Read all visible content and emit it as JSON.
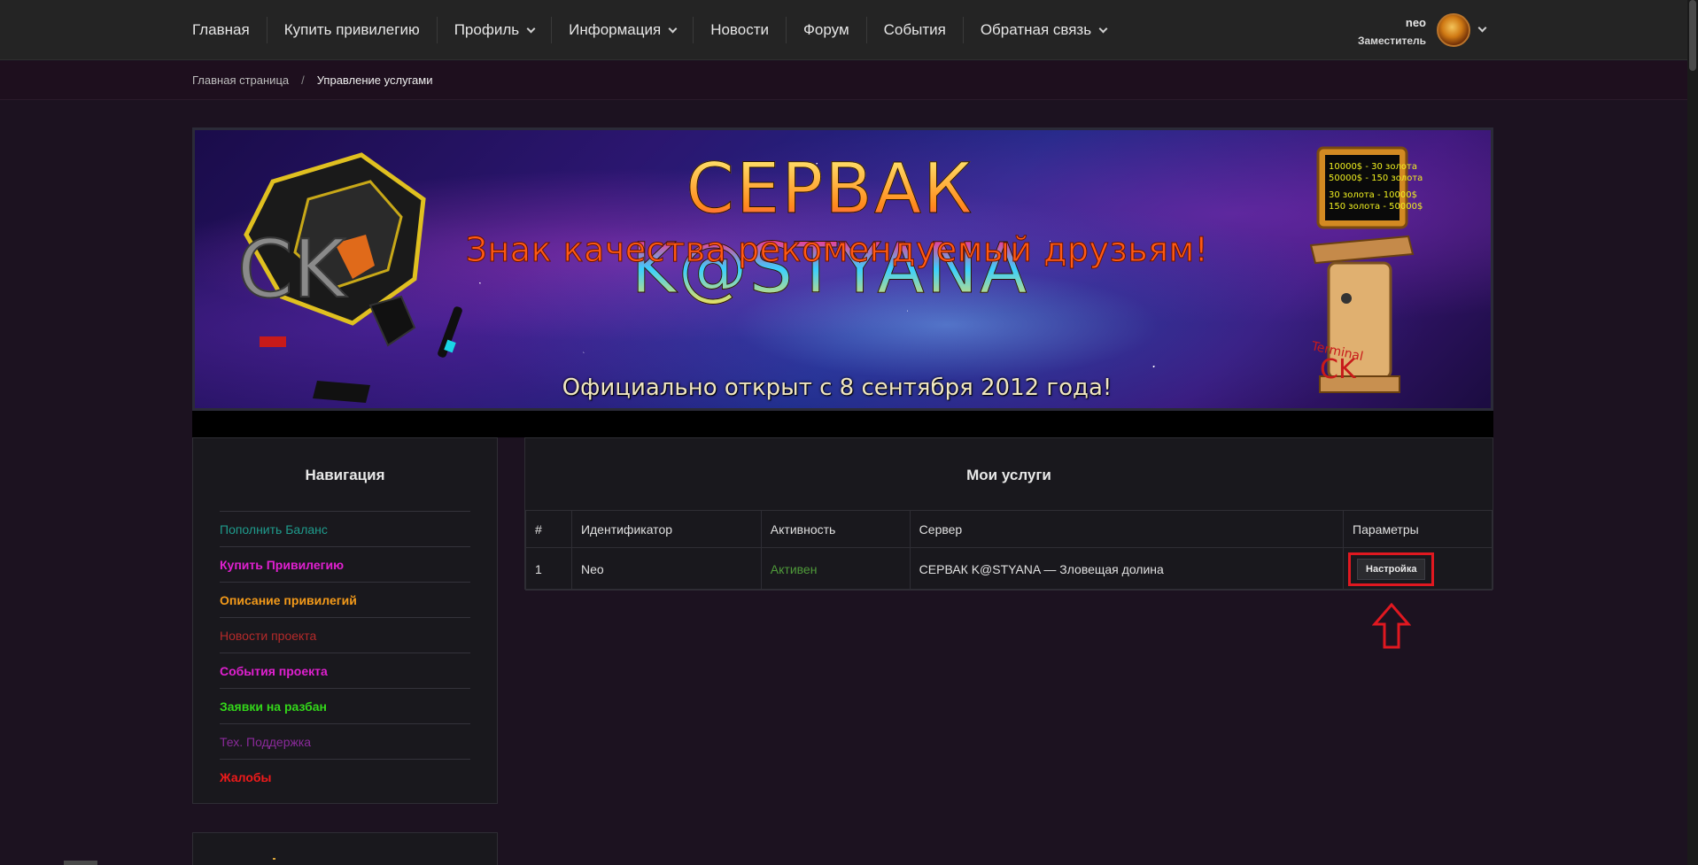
{
  "nav": {
    "items": [
      {
        "label": "Главная",
        "dropdown": false
      },
      {
        "label": "Купить привилегию",
        "dropdown": false
      },
      {
        "label": "Профиль",
        "dropdown": true
      },
      {
        "label": "Информация",
        "dropdown": true
      },
      {
        "label": "Новости",
        "dropdown": false
      },
      {
        "label": "Форум",
        "dropdown": false
      },
      {
        "label": "События",
        "dropdown": false
      },
      {
        "label": "Обратная связь",
        "dropdown": true
      }
    ],
    "user": {
      "name": "neo",
      "role": "Заместитель"
    }
  },
  "breadcrumb": {
    "home": "Главная страница",
    "separator": "/",
    "current": "Управление услугами"
  },
  "banner": {
    "title": "СЕРВАК K@STYANA",
    "subtitle": "Знак качества рекомендуемый друзьям!",
    "footer": "Официально открыт с 8 сентября 2012 года!",
    "logo_text": "CK",
    "terminal": {
      "screen_lines": [
        "10000$ - 30 золота",
        "50000$ - 150 золота",
        "30 золота - 10000$",
        "150 золота - 50000$"
      ],
      "label_top": "Terminal",
      "label_bottom": "CK"
    }
  },
  "sidebar": {
    "title": "Навигация",
    "items": [
      {
        "label": "Пополнить Баланс",
        "color": "#1f9b8c",
        "bold": false
      },
      {
        "label": "Купить Привилегию",
        "color": "#e020d0",
        "bold": true
      },
      {
        "label": "Описание привилегий",
        "color": "#f39a1a",
        "bold": true
      },
      {
        "label": "Новости проекта",
        "color": "#b42a2a",
        "bold": false
      },
      {
        "label": "События проекта",
        "color": "#e020d0",
        "bold": true
      },
      {
        "label": "Заявки на разбан",
        "color": "#33d61a",
        "bold": true
      },
      {
        "label": "Тех. Поддержка",
        "color": "#8a2a9a",
        "bold": false
      },
      {
        "label": "Жалобы",
        "color": "#f01a1a",
        "bold": true
      }
    ]
  },
  "services": {
    "title": "Мои услуги",
    "columns": [
      "#",
      "Идентификатор",
      "Активность",
      "Сервер",
      "Параметры"
    ],
    "rows": [
      {
        "num": "1",
        "id": "Neo",
        "status": "Активен",
        "server": "СЕРВАК K@STYANA — Зловещая долина",
        "action": "Настройка"
      }
    ]
  },
  "colors": {
    "active_status": "#4f9a3a",
    "highlight": "#e01820",
    "page_bg": "#1c1220",
    "topbar_bg": "#242424"
  },
  "icons": {
    "dropdown": "chevron-down-icon",
    "annotation": "arrow-up-outline-icon"
  }
}
